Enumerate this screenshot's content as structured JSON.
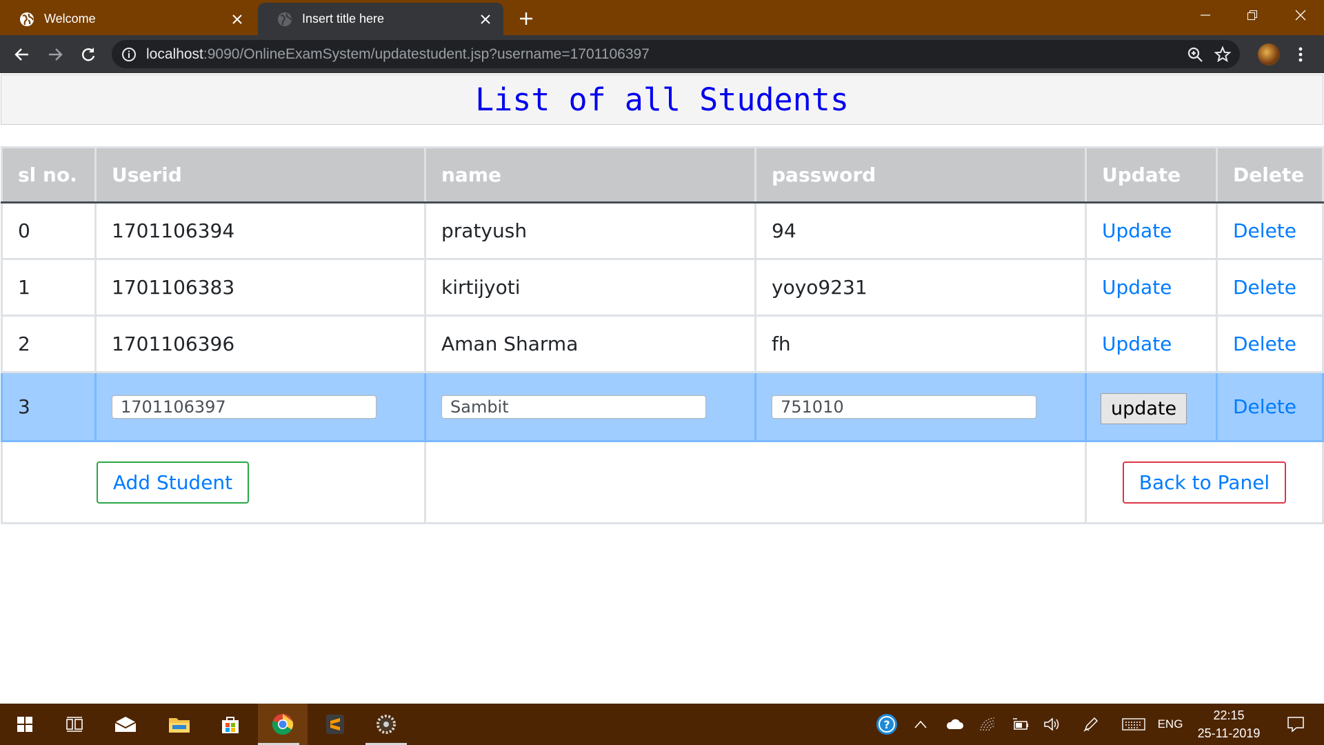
{
  "browser": {
    "tabs": [
      {
        "title": "Welcome",
        "active": false,
        "icon": "globe-icon"
      },
      {
        "title": "Insert title here",
        "active": true,
        "icon": "globe-icon"
      }
    ],
    "url_host": "localhost",
    "url_rest": ":9090/OnlineExamSystem/updatestudent.jsp?username=1701106397"
  },
  "page": {
    "title": "List of all Students"
  },
  "table": {
    "headers": [
      "sl no.",
      "Userid",
      "name",
      "password",
      "Update",
      "Delete"
    ],
    "rows": [
      {
        "sl": "0",
        "userid": "1701106394",
        "name": "pratyush",
        "password": "94",
        "update": "Update",
        "delete": "Delete"
      },
      {
        "sl": "1",
        "userid": "1701106383",
        "name": "kirtijyoti",
        "password": "yoyo9231",
        "update": "Update",
        "delete": "Delete"
      },
      {
        "sl": "2",
        "userid": "1701106396",
        "name": "Aman Sharma",
        "password": "fh",
        "update": "Update",
        "delete": "Delete"
      }
    ],
    "edit_row": {
      "sl": "3",
      "userid": "1701106397",
      "name": "Sambit",
      "password": "751010",
      "submit": "update",
      "delete": "Delete"
    },
    "add_button": "Add Student",
    "back_button": "Back to Panel"
  },
  "taskbar": {
    "language": "ENG",
    "time": "22:15",
    "date": "25-11-2019"
  },
  "colors": {
    "titlebar": "#773e00",
    "taskbar": "#4e2502",
    "heading": "#0000ee",
    "link": "#007bff",
    "edit_row": "#9fcdff",
    "success": "#28a745",
    "danger": "#dc3545"
  }
}
